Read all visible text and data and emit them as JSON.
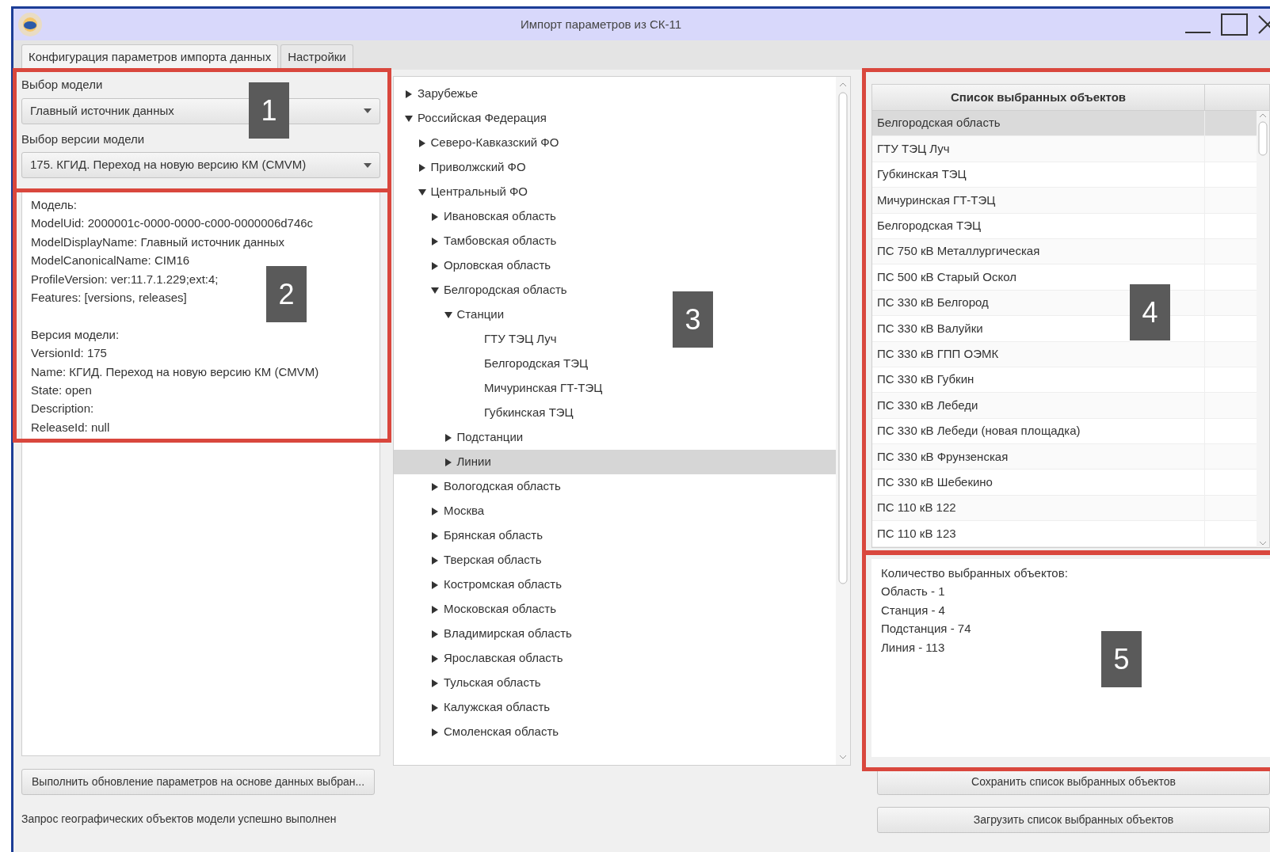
{
  "window": {
    "title": "Импорт параметров из СК-11"
  },
  "tabs": [
    {
      "label": "Конфигурация параметров импорта данных",
      "selected": true
    },
    {
      "label": "Настройки",
      "selected": false
    }
  ],
  "model_select": {
    "label": "Выбор модели",
    "value": "Главный источник данных"
  },
  "version_select": {
    "label": "Выбор версии модели",
    "value": "175. КГИД. Переход на новую версию КМ (CMVM)"
  },
  "info_groups": [
    [
      "Модель:",
      "ModelUid: 2000001c-0000-0000-c000-0000006d746c",
      "ModelDisplayName: Главный источник данных",
      "ModelCanonicalName: CIM16",
      "ProfileVersion: ver:11.7.1.229;ext:4;",
      "Features: [versions, releases]"
    ],
    [
      "Версия модели:",
      "VersionId: 175",
      "Name: КГИД. Переход на новую версию КМ (CMVM)",
      "State: open",
      "Description:",
      "ReleaseId: null"
    ]
  ],
  "tree": [
    {
      "label": "Зарубежье",
      "expanded": false,
      "selected": false
    },
    {
      "label": "Российская Федерация",
      "expanded": true,
      "selected": false,
      "children": [
        {
          "label": "Северо-Кавказский ФО",
          "expanded": false,
          "selected": false
        },
        {
          "label": "Приволжский ФО",
          "expanded": false,
          "selected": false
        },
        {
          "label": "Центральный ФО",
          "expanded": true,
          "selected": false,
          "children": [
            {
              "label": "Ивановская область",
              "expanded": false,
              "selected": false
            },
            {
              "label": "Тамбовская область",
              "expanded": false,
              "selected": false
            },
            {
              "label": "Орловская область",
              "expanded": false,
              "selected": false
            },
            {
              "label": "Белгородская область",
              "expanded": true,
              "selected": false,
              "children": [
                {
                  "label": "Станции",
                  "expanded": true,
                  "selected": false,
                  "children": [
                    {
                      "label": "ГТУ ТЭЦ Луч",
                      "selected": false
                    },
                    {
                      "label": "Белгородская ТЭЦ",
                      "selected": false
                    },
                    {
                      "label": "Мичуринская ГТ-ТЭЦ",
                      "selected": false
                    },
                    {
                      "label": "Губкинская ТЭЦ",
                      "selected": false
                    }
                  ]
                },
                {
                  "label": "Подстанции",
                  "expanded": false,
                  "selected": false
                },
                {
                  "label": "Линии",
                  "expanded": false,
                  "selected": true
                }
              ]
            },
            {
              "label": "Вологодская область",
              "expanded": false,
              "selected": false
            },
            {
              "label": "Москва",
              "expanded": false,
              "selected": false
            },
            {
              "label": "Брянская область",
              "expanded": false,
              "selected": false
            },
            {
              "label": "Тверская область",
              "expanded": false,
              "selected": false
            },
            {
              "label": "Костромская область",
              "expanded": false,
              "selected": false
            },
            {
              "label": "Московская область",
              "expanded": false,
              "selected": false
            },
            {
              "label": "Владимирская область",
              "expanded": false,
              "selected": false
            },
            {
              "label": "Ярославская область",
              "expanded": false,
              "selected": false
            },
            {
              "label": "Тульская область",
              "expanded": false,
              "selected": false
            },
            {
              "label": "Калужская область",
              "expanded": false,
              "selected": false
            },
            {
              "label": "Смоленская область",
              "expanded": false,
              "selected": false
            }
          ]
        }
      ]
    }
  ],
  "selected_list": {
    "column_1": "Список выбранных объектов",
    "rows": [
      {
        "name": "Белгородская область",
        "selected": true
      },
      {
        "name": "ГТУ ТЭЦ Луч",
        "selected": false
      },
      {
        "name": "Губкинская ТЭЦ",
        "selected": false
      },
      {
        "name": "Мичуринская ГТ-ТЭЦ",
        "selected": false
      },
      {
        "name": "Белгородская ТЭЦ",
        "selected": false
      },
      {
        "name": "ПС 750 кВ Металлургическая",
        "selected": false
      },
      {
        "name": "ПС 500 кВ Старый Оскол",
        "selected": false
      },
      {
        "name": "ПС 330 кВ Белгород",
        "selected": false
      },
      {
        "name": "ПС 330 кВ Валуйки",
        "selected": false
      },
      {
        "name": "ПС 330 кВ ГПП ОЭМК",
        "selected": false
      },
      {
        "name": "ПС 330 кВ Губкин",
        "selected": false
      },
      {
        "name": "ПС 330 кВ Лебеди",
        "selected": false
      },
      {
        "name": "ПС 330 кВ Лебеди (новая площадка)",
        "selected": false
      },
      {
        "name": "ПС 330 кВ Фрунзенская",
        "selected": false
      },
      {
        "name": "ПС 330 кВ Шебекино",
        "selected": false
      },
      {
        "name": "ПС 110 кВ 122",
        "selected": false
      },
      {
        "name": "ПС 110 кВ 123",
        "selected": false
      }
    ]
  },
  "count_lines": [
    "Количество выбранных объектов:",
    "Область - 1",
    "Станция - 4",
    "Подстанция - 74",
    "Линия - 113"
  ],
  "update_button": "Выполнить обновление параметров на основе данных выбран...",
  "status": "Запрос географических объектов модели успешно выполнен",
  "save_button": "Сохранить список выбранных объектов",
  "load_button": "Загрузить список выбранных объектов",
  "annotations": [
    "1",
    "2",
    "3",
    "4",
    "5"
  ]
}
